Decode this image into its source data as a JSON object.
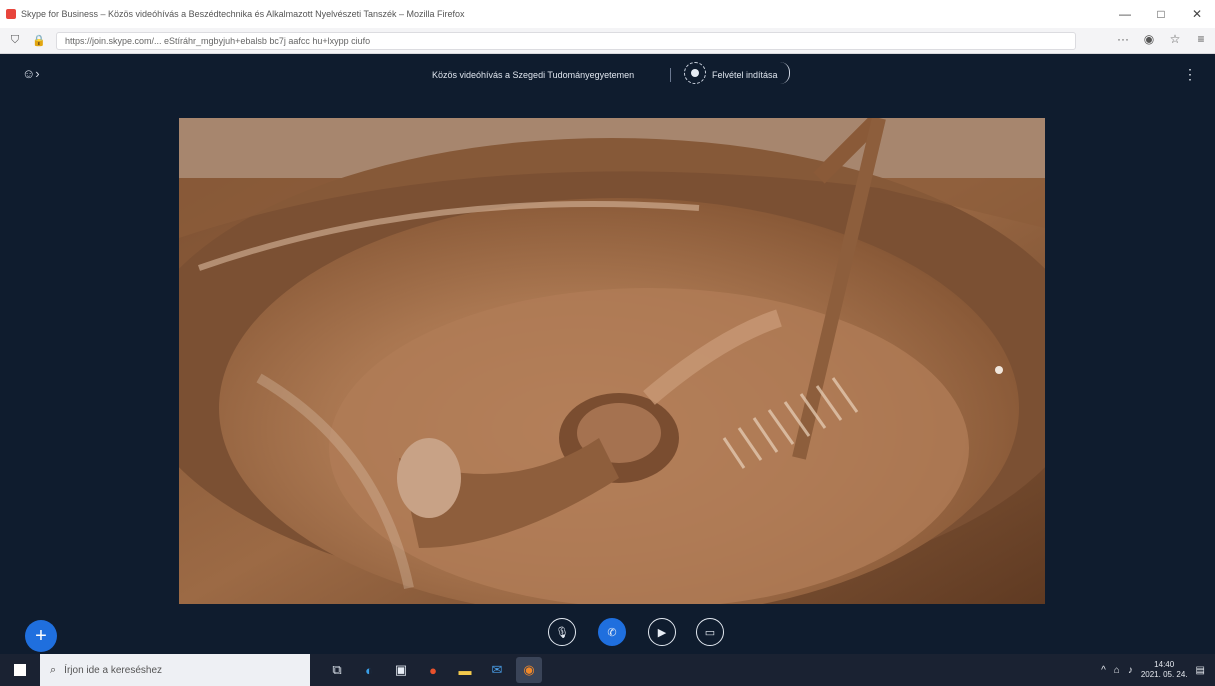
{
  "browser": {
    "window_title": "Skype for Business – Közös videóhívás a Beszédtechnika és Alkalmazott Nyelvészeti Tanszék – Mozilla Firefox",
    "url": "https://join.skype.com/... eStíráhr_mgbyjuh+ebalsb bc7j aafcc hu+lxypp ciufo",
    "window_controls": [
      "minimize-icon",
      "maximize-icon",
      "close-icon"
    ],
    "toolbar_icons": [
      "shield-icon",
      "lock-icon",
      "more-icon",
      "pocket-icon",
      "star-icon",
      "menu-icon"
    ]
  },
  "call": {
    "title": "Közös videóhívás a Szegedi Tudományegyetemen",
    "record_label": "Felvétel indítása",
    "controls": {
      "mute": "microphone-off-icon",
      "hangup": "phone-icon",
      "video": "camera-icon",
      "chat": "chat-icon"
    }
  },
  "taskbar": {
    "search_placeholder": "Írjon ide a kereséshez",
    "clock_time": "14:40",
    "clock_date": "2021. 05. 24.",
    "apps": [
      "task-view-icon",
      "edge-icon",
      "store-icon",
      "office-icon",
      "explorer-icon",
      "mail-icon",
      "firefox-icon"
    ]
  },
  "colors": {
    "app_bg": "#0f1c2e",
    "accent": "#1f6fde",
    "chocolate": "#a8744f"
  }
}
